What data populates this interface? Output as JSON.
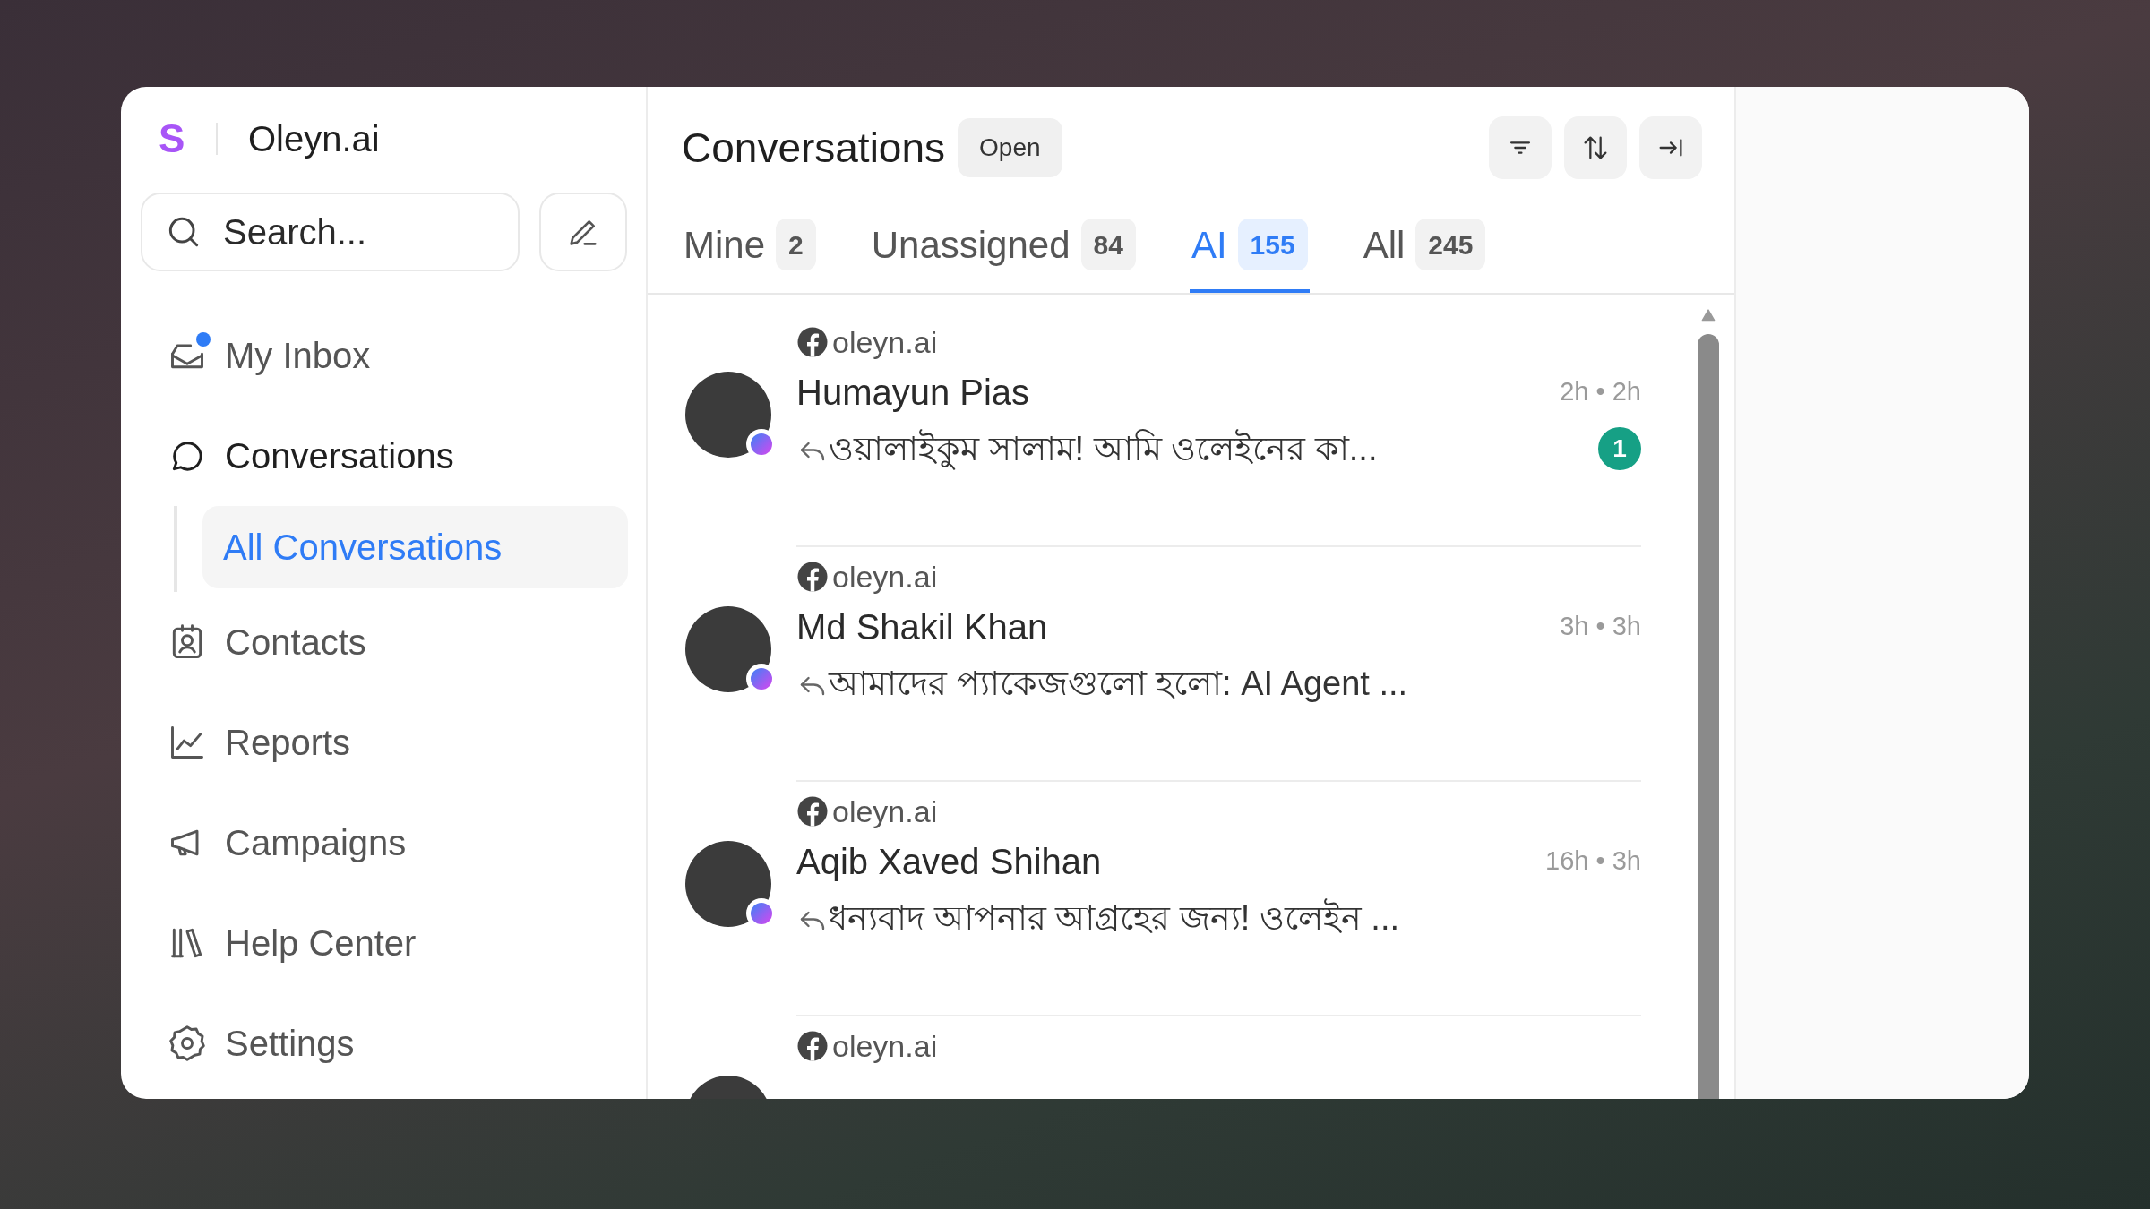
{
  "sidebar": {
    "logo": "S",
    "workspace": "Oleyn.ai",
    "search": {
      "placeholder": "Search..."
    },
    "nav": [
      {
        "label": "My Inbox",
        "notification_dot": true,
        "expanded": false
      },
      {
        "label": "Conversations",
        "notification_dot": false,
        "expanded": true,
        "children": [
          {
            "label": "All Conversations",
            "selected": true
          }
        ]
      },
      {
        "label": "Contacts",
        "notification_dot": false,
        "expanded": false
      },
      {
        "label": "Reports",
        "notification_dot": false,
        "expanded": false
      },
      {
        "label": "Campaigns",
        "notification_dot": false,
        "expanded": false
      },
      {
        "label": "Help Center",
        "notification_dot": false,
        "expanded": false
      },
      {
        "label": "Settings",
        "notification_dot": false,
        "expanded": false
      }
    ]
  },
  "conversations": {
    "title": "Conversations",
    "status": "Open",
    "tabs": [
      {
        "label": "Mine",
        "count": "2",
        "selected": false
      },
      {
        "label": "Unassigned",
        "count": "84",
        "selected": false
      },
      {
        "label": "AI",
        "count": "155",
        "selected": true
      },
      {
        "label": "All",
        "count": "245",
        "selected": false
      }
    ],
    "items": [
      {
        "source": "oleyn.ai",
        "name": "Humayun Pias",
        "time": "2h • 2h",
        "preview": "ওয়ালাইকুম সালাম! আমি ওলেইনের কা...",
        "unread": "1"
      },
      {
        "source": "oleyn.ai",
        "name": "Md Shakil Khan",
        "time": "3h • 3h",
        "preview": "আমাদের প্যাকেজগুলো হলো: AI Agent ..."
      },
      {
        "source": "oleyn.ai",
        "name": "Aqib Xaved Shihan",
        "time": "16h • 3h",
        "preview": "ধন্যবাদ আপনার আগ্রহের জন্য! ওলেইন ..."
      },
      {
        "source": "oleyn.ai"
      }
    ]
  }
}
